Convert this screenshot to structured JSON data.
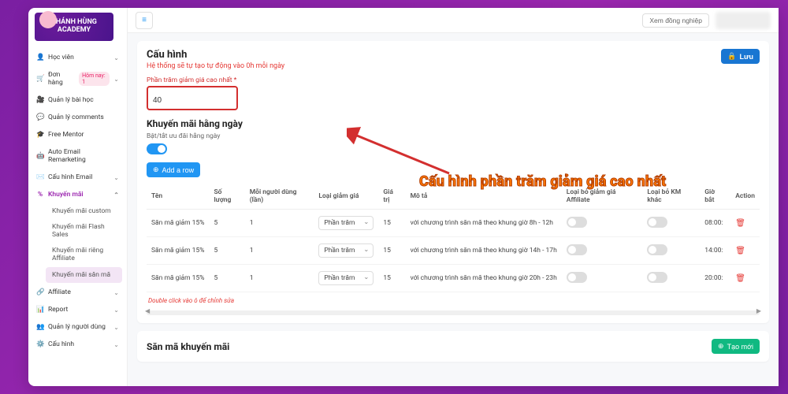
{
  "brand": "KHÁNH HÙNG ACADEMY",
  "topbar": {
    "view_colleagues": "Xem đồng nghiệp"
  },
  "sidebar": {
    "items": [
      {
        "icon": "👤",
        "label": "Học viên",
        "chev": true
      },
      {
        "icon": "🛒",
        "label": "Đơn hàng",
        "chev": true,
        "badge": "Hôm nay: 1"
      },
      {
        "icon": "🎥",
        "label": "Quản lý bài học"
      },
      {
        "icon": "💬",
        "label": "Quản lý comments"
      },
      {
        "icon": "🎓",
        "label": "Free Mentor"
      },
      {
        "icon": "🤖",
        "label": "Auto Email Remarketing"
      },
      {
        "icon": "✉️",
        "label": "Cấu hình Email",
        "chev": true
      },
      {
        "icon": "%",
        "label": "Khuyến mãi",
        "chev": true,
        "active": true
      }
    ],
    "promo_children": [
      "Khuyến mãi custom",
      "Khuyến mãi Flash Sales",
      "Khuyến mãi riêng Affiliate",
      "Khuyến mãi săn mã"
    ],
    "tail": [
      {
        "icon": "🔗",
        "label": "Affiliate",
        "chev": true
      },
      {
        "icon": "📊",
        "label": "Report",
        "chev": true
      },
      {
        "icon": "👥",
        "label": "Quản lý người dùng",
        "chev": true
      },
      {
        "icon": "⚙️",
        "label": "Cấu hình",
        "chev": true
      }
    ]
  },
  "page": {
    "title": "Cấu hình",
    "subtitle": "Hệ thống sẽ tự tạo tự động vào 0h mỗi ngày",
    "save_btn": "Lưu",
    "pct_label": "Phần trăm giảm giá cao nhất",
    "pct_value": "40",
    "daily_title": "Khuyến mãi hằng ngày",
    "daily_sub": "Bật/tắt ưu đãi hằng ngày",
    "add_row": "Add a row",
    "hint": "Double click vào ô để chỉnh sửa",
    "columns": [
      "Tên",
      "Số lượng",
      "Mỗi người dùng (lần)",
      "Loại giảm giá",
      "Giá trị",
      "Mô tả",
      "Loại bỏ giảm giá Affiliate",
      "Loại bỏ KM khác",
      "Giờ bắt",
      "Action"
    ],
    "rows": [
      {
        "name": "Săn mã giảm 15%",
        "qty": "5",
        "per": "1",
        "type": "Phần trăm",
        "val": "15",
        "desc": "với chương trình săn mã theo khung giờ 8h - 12h",
        "time": "08:00:"
      },
      {
        "name": "Săn mã giảm 15%",
        "qty": "5",
        "per": "1",
        "type": "Phần trăm",
        "val": "15",
        "desc": "với chương trình săn mã theo khung giờ 14h - 17h",
        "time": "14:00:"
      },
      {
        "name": "Săn mã giảm 15%",
        "qty": "5",
        "per": "1",
        "type": "Phần trăm",
        "val": "15",
        "desc": "với chương trình săn mã theo khung giờ 20h - 23h",
        "time": "20:00:"
      }
    ],
    "hunt_title": "Săn mã khuyến mãi",
    "new_btn": "Tạo mới"
  },
  "annotation": "Cấu hình phần trăm giảm giá cao nhất"
}
